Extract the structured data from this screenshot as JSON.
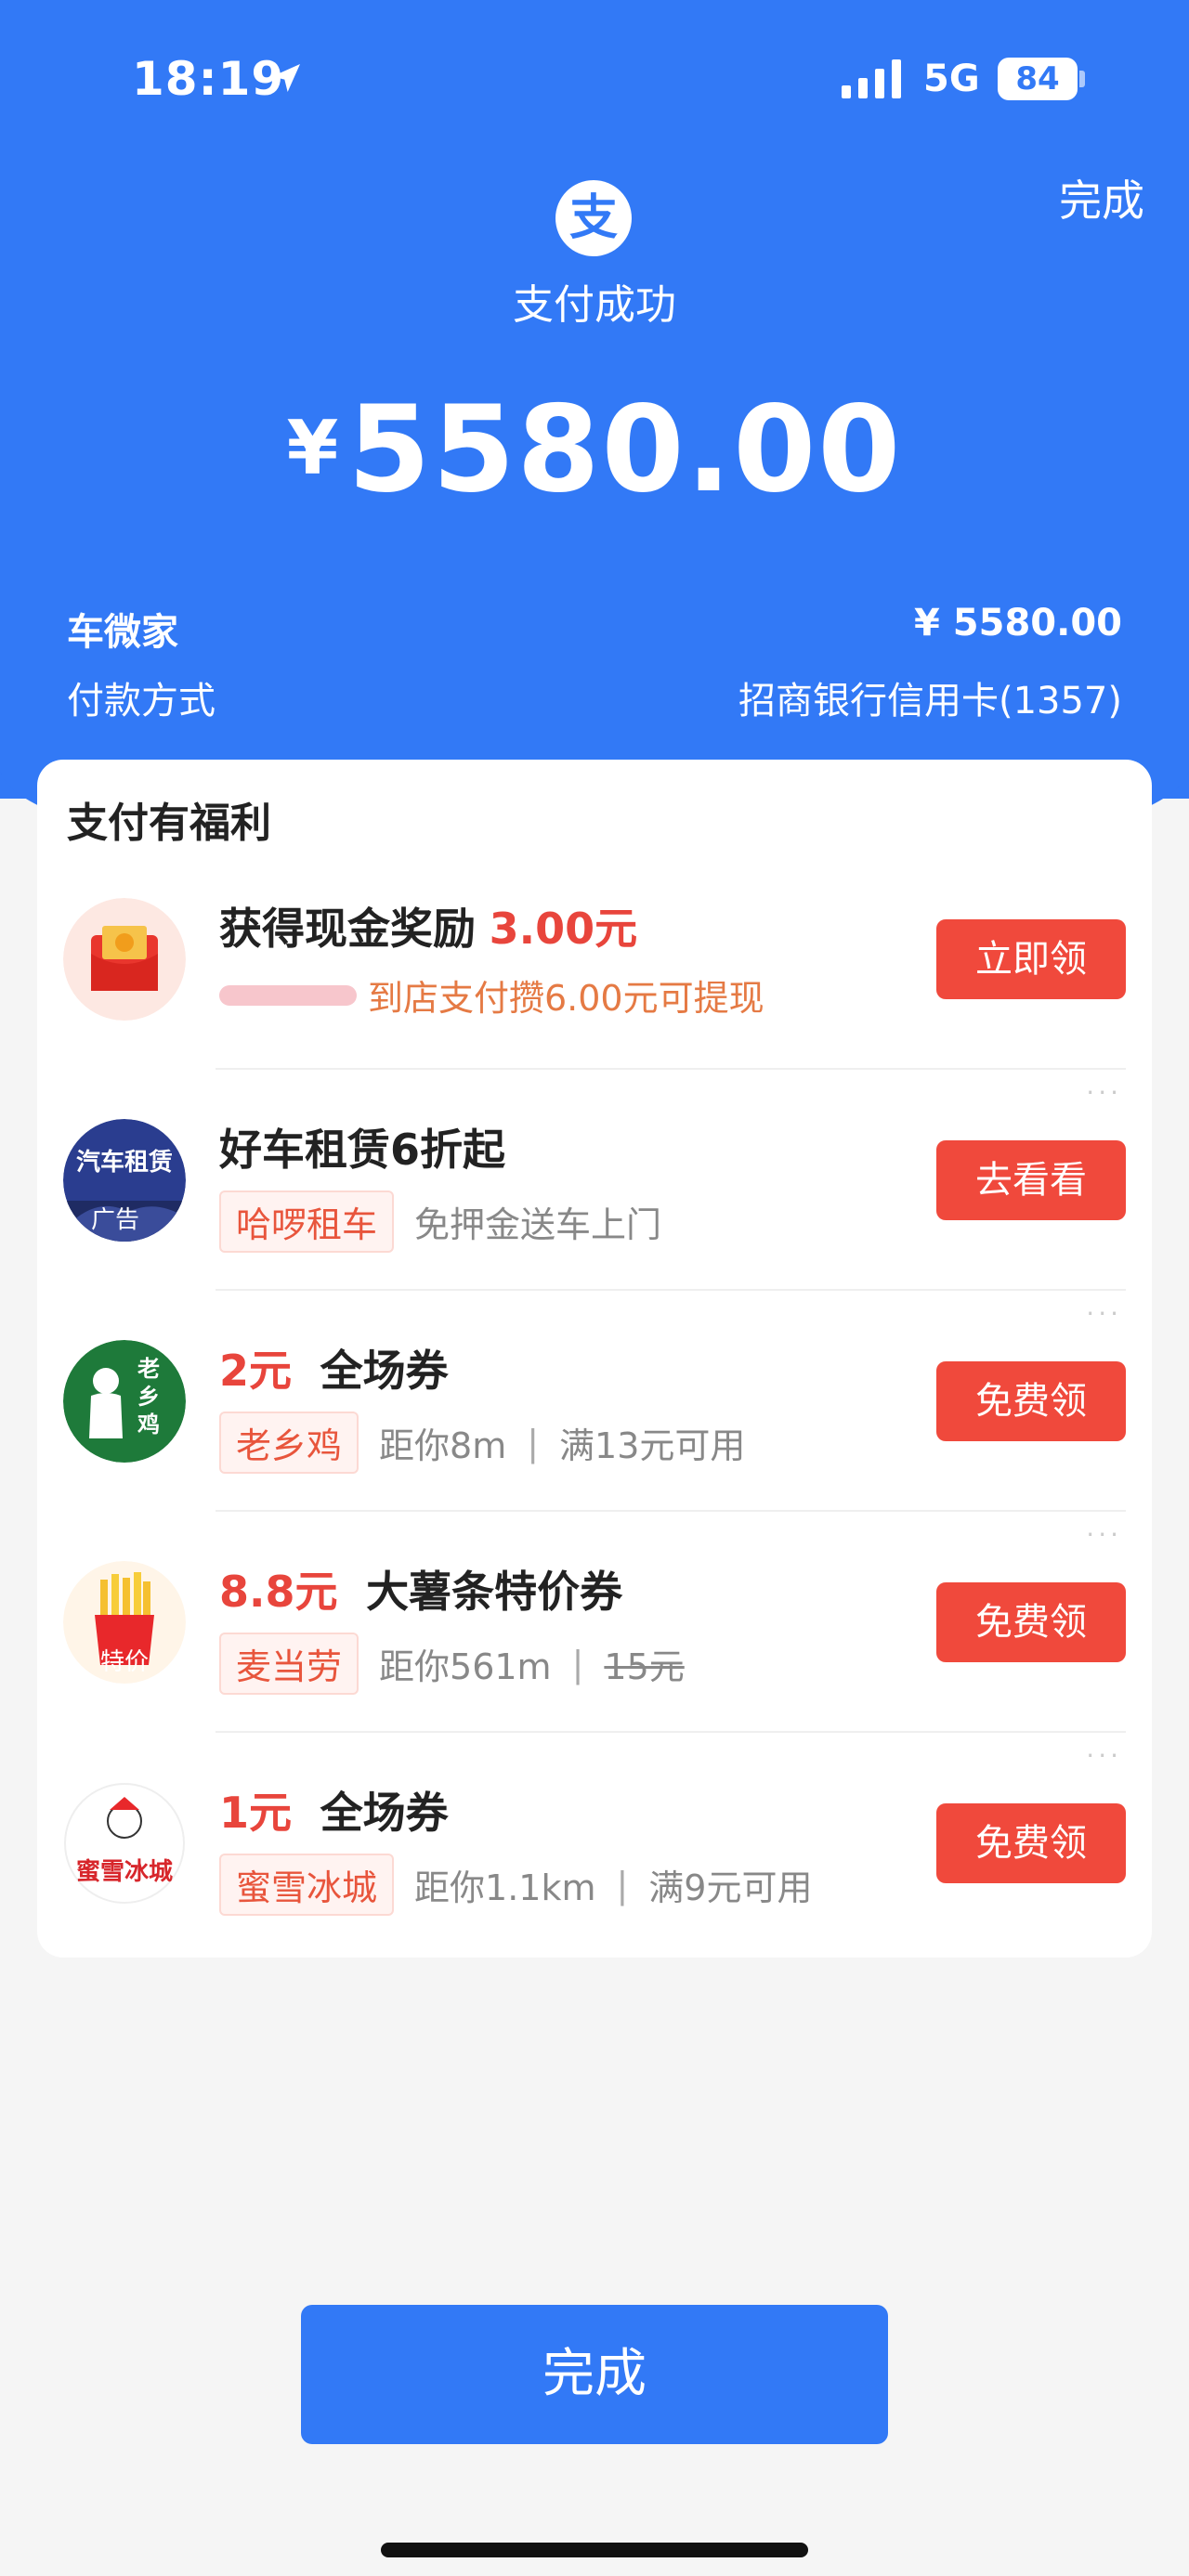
{
  "status_bar": {
    "time": "18:19",
    "network": "5G",
    "battery": "84"
  },
  "header": {
    "done_label": "完成",
    "status": "支付成功",
    "currency": "¥",
    "amount": "5580.00"
  },
  "details": {
    "merchant_label": "车微家",
    "merchant_amount": "¥ 5580.00",
    "method_label": "付款方式",
    "method_value": "招商银行信用卡(1357)"
  },
  "benefits": {
    "title": "支付有福利",
    "offers": [
      {
        "title_prefix": "获得现金奖励",
        "highlight": "3.00元",
        "subtitle": "到店支付攒6.00元可提现",
        "button": "立即领"
      },
      {
        "title": "好车租赁6折起",
        "tag": "哈啰租车",
        "desc": "免押金送车上门",
        "logo_text": "汽车租赁",
        "logo_ad": "广告",
        "button": "去看看",
        "more": "···"
      },
      {
        "highlight": "2元",
        "title": "全场券",
        "tag": "老乡鸡",
        "distance": "距你8m",
        "sep": "|",
        "condition": "满13元可用",
        "logo_text": "老乡鸡",
        "button": "免费领",
        "more": "···"
      },
      {
        "highlight": "8.8元",
        "title": "大薯条特价券",
        "tag": "麦当劳",
        "distance": "距你561m",
        "sep": "|",
        "original_price": "15元",
        "logo_text": "特价",
        "button": "免费领",
        "more": "···"
      },
      {
        "highlight": "1元",
        "title": "全场券",
        "tag": "蜜雪冰城",
        "distance": "距你1.1km",
        "sep": "|",
        "condition": "满9元可用",
        "logo_text": "蜜雪冰城",
        "button": "免费领",
        "more": "···"
      }
    ]
  },
  "footer": {
    "done_button": "完成"
  }
}
